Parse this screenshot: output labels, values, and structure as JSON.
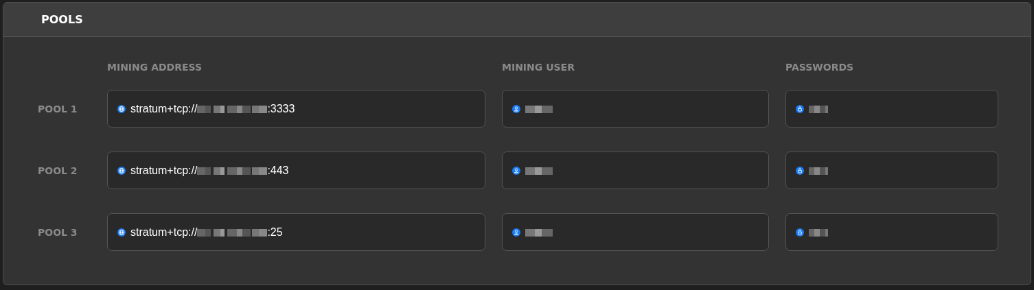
{
  "panel": {
    "title": "POOLS"
  },
  "columns": [
    "MINING ADDRESS",
    "MINING USER",
    "PASSWORDS"
  ],
  "pools": [
    {
      "label": "POOL 1",
      "address_prefix": "stratum+tcp://",
      "address_suffix": ":3333"
    },
    {
      "label": "POOL 2",
      "address_prefix": "stratum+tcp://",
      "address_suffix": ":443"
    },
    {
      "label": "POOL 3",
      "address_prefix": "stratum+tcp://",
      "address_suffix": ":25"
    }
  ]
}
